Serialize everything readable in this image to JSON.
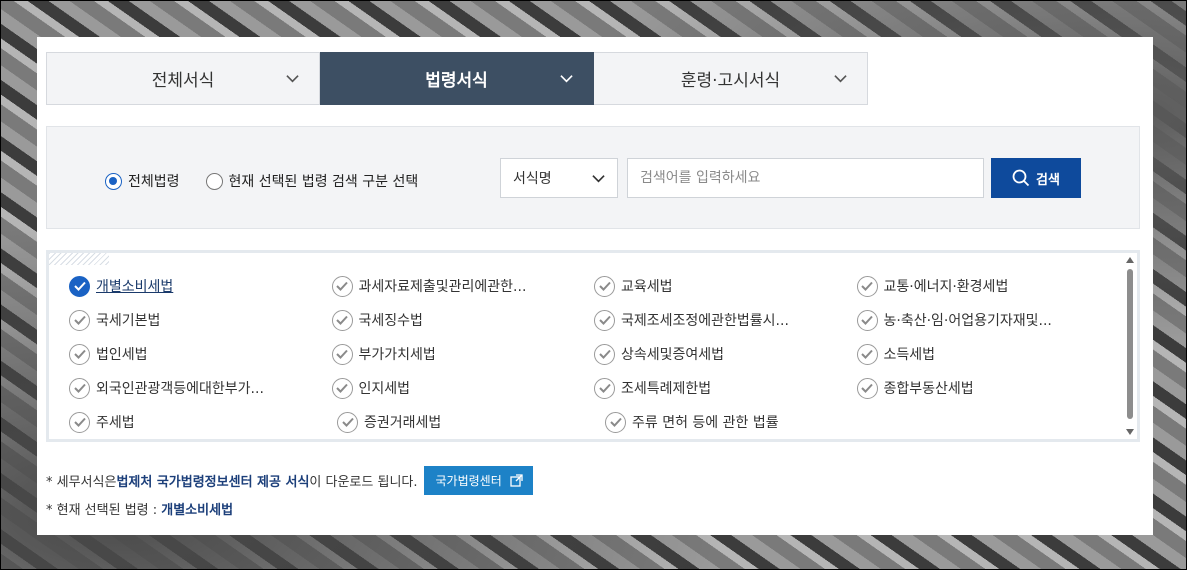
{
  "tabs": [
    {
      "label": "전체서식",
      "active": false
    },
    {
      "label": "법령서식",
      "active": true
    },
    {
      "label": "훈령·고시서식",
      "active": false
    }
  ],
  "search": {
    "radio_all": "전체법령",
    "radio_selected": "현재 선택된 법령 검색 구분 선택",
    "select_value": "서식명",
    "placeholder": "검색어를 입력하세요",
    "button_label": "검색"
  },
  "laws": [
    [
      "개별소비세법",
      "과세자료제출및관리에관한...",
      "교육세법",
      "교통·에너지·환경세법"
    ],
    [
      "국세기본법",
      "국세징수법",
      "국제조세조정에관한법률시...",
      "농·축산·임·어업용기자재및..."
    ],
    [
      "법인세법",
      "부가가치세법",
      "상속세및증여세법",
      "소득세법"
    ],
    [
      "외국인관광객등에대한부가...",
      "인지세법",
      "조세특례제한법",
      "종합부동산세법"
    ],
    [
      "주세법",
      "증권거래세법",
      "주류 면허 등에 관한 법률"
    ]
  ],
  "selected_law": "개별소비세법",
  "notes": {
    "note1_prefix": "* 세무서식은 ",
    "note1_bold": "법제처 국가법령정보센터 제공 서식",
    "note1_suffix": "이 다운로드 됩니다.",
    "center_button": "국가법령센터",
    "note2_prefix": "* 현재 선택된 법령 : ",
    "note2_value": "개별소비세법"
  },
  "colors": {
    "tab_active": "#3d4f63",
    "accent_blue": "#1a62c4",
    "search_button": "#0e4a9c",
    "center_button": "#1d82c7"
  }
}
